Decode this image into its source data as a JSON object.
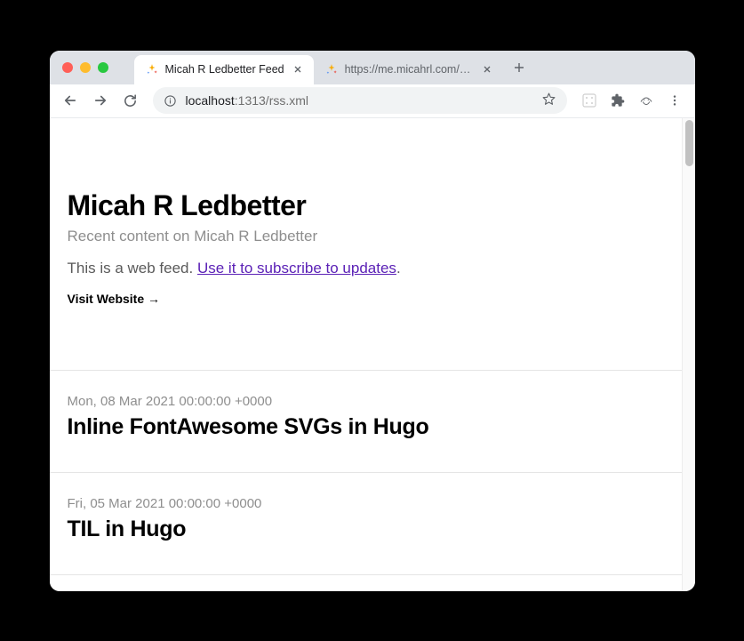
{
  "window": {
    "tabs": [
      {
        "title": "Micah R Ledbetter Feed",
        "active": true
      },
      {
        "title": "https://me.micahrl.com/rss.xml",
        "active": false
      }
    ]
  },
  "address": {
    "host": "localhost",
    "port_path": ":1313/rss.xml"
  },
  "feed": {
    "title": "Micah R Ledbetter",
    "subtitle": "Recent content on Micah R Ledbetter",
    "desc_prefix": "This is a web feed. ",
    "desc_link": "Use it to subscribe to updates",
    "desc_suffix": ".",
    "visit": "Visit Website →"
  },
  "entries": [
    {
      "date": "Mon, 08 Mar 2021 00:00:00 +0000",
      "title": "Inline FontAwesome SVGs in Hugo"
    },
    {
      "date": "Fri, 05 Mar 2021 00:00:00 +0000",
      "title": "TIL in Hugo"
    }
  ]
}
